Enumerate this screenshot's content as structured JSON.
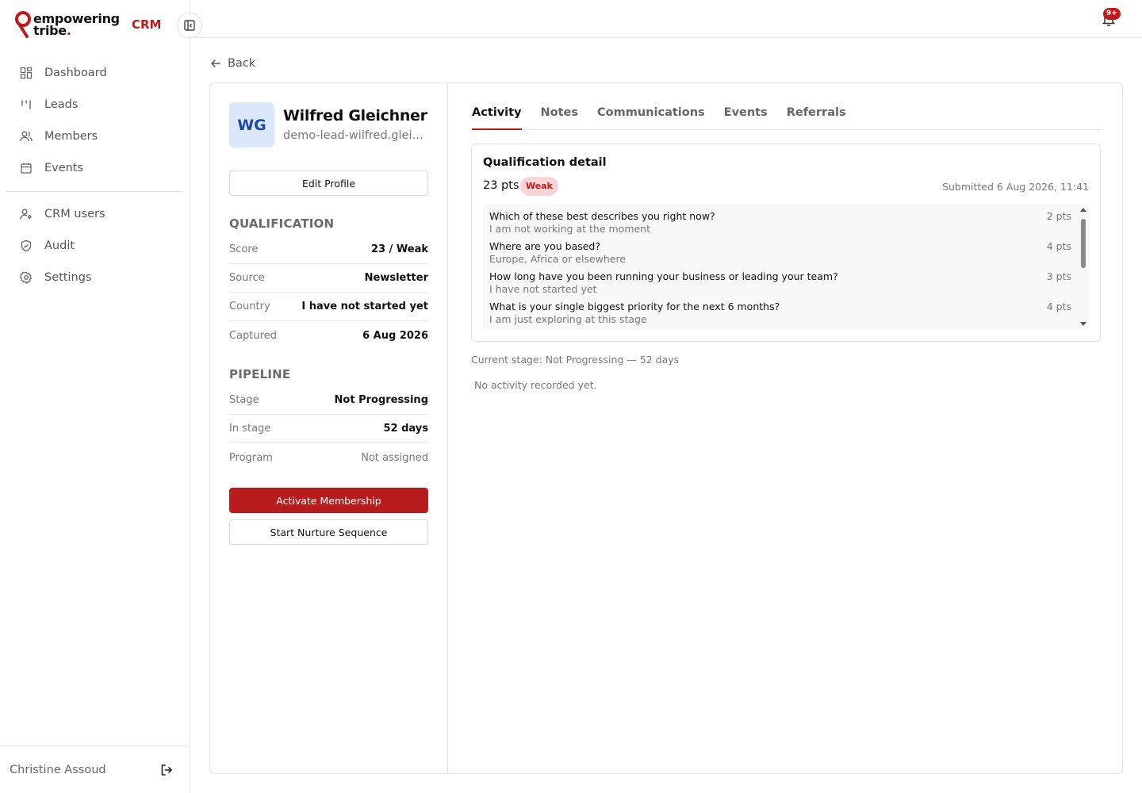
{
  "brand": {
    "line1": "empowering",
    "line2": "tribe",
    "dot": ".",
    "product": "CRM"
  },
  "sidebar": {
    "items": [
      {
        "label": "Dashboard",
        "icon": "dashboard-icon"
      },
      {
        "label": "Leads",
        "icon": "leads-icon"
      },
      {
        "label": "Members",
        "icon": "members-icon"
      },
      {
        "label": "Events",
        "icon": "calendar-icon"
      }
    ],
    "admin_items": [
      {
        "label": "CRM users",
        "icon": "users-icon"
      },
      {
        "label": "Audit",
        "icon": "shield-icon"
      },
      {
        "label": "Settings",
        "icon": "gear-icon"
      }
    ],
    "user_name": "Christine Assoud"
  },
  "topbar": {
    "notification_count": "9+"
  },
  "back_label": "Back",
  "lead": {
    "initials": "WG",
    "name": "Wilfred Gleichner",
    "id": "demo-lead-wilfred.gleichner",
    "edit_label": "Edit Profile"
  },
  "qualification": {
    "title": "QUALIFICATION",
    "rows": [
      {
        "key": "Score",
        "value": "23 / Weak"
      },
      {
        "key": "Source",
        "value": "Newsletter"
      },
      {
        "key": "Country",
        "value": "I have not started yet"
      },
      {
        "key": "Captured",
        "value": "6 Aug 2026"
      }
    ]
  },
  "pipeline": {
    "title": "PIPELINE",
    "rows": [
      {
        "key": "Stage",
        "value": "Not Progressing"
      },
      {
        "key": "In stage",
        "value": "52 days"
      },
      {
        "key": "Program",
        "value": "Not assigned"
      }
    ]
  },
  "actions": {
    "activate": "Activate Membership",
    "nurture": "Start Nurture Sequence"
  },
  "tabs": [
    "Activity",
    "Notes",
    "Communications",
    "Events",
    "Referrals"
  ],
  "qual_detail": {
    "title": "Qualification detail",
    "points": "23 pts",
    "badge": "Weak",
    "submitted": "Submitted 6 Aug 2026, 11:41",
    "items": [
      {
        "q": "Which of these best describes you right now?",
        "a": "I am not working at the moment",
        "pts": "2 pts"
      },
      {
        "q": "Where are you based?",
        "a": "Europe, Africa or elsewhere",
        "pts": "4 pts"
      },
      {
        "q": "How long have you been running your business or leading your team?",
        "a": "I have not started yet",
        "pts": "3 pts"
      },
      {
        "q": "What is your single biggest priority for the next 6 months?",
        "a": "I am just exploring at this stage",
        "pts": "4 pts"
      }
    ]
  },
  "stage_line": "Current stage: Not Progressing — 52 days",
  "no_activity": "No activity recorded yet.",
  "colors": {
    "brand_red": "#c0191c",
    "avatar_bg": "#dbe7fb",
    "avatar_fg": "#1f47a8",
    "weak_bg": "#fbd5d5"
  }
}
